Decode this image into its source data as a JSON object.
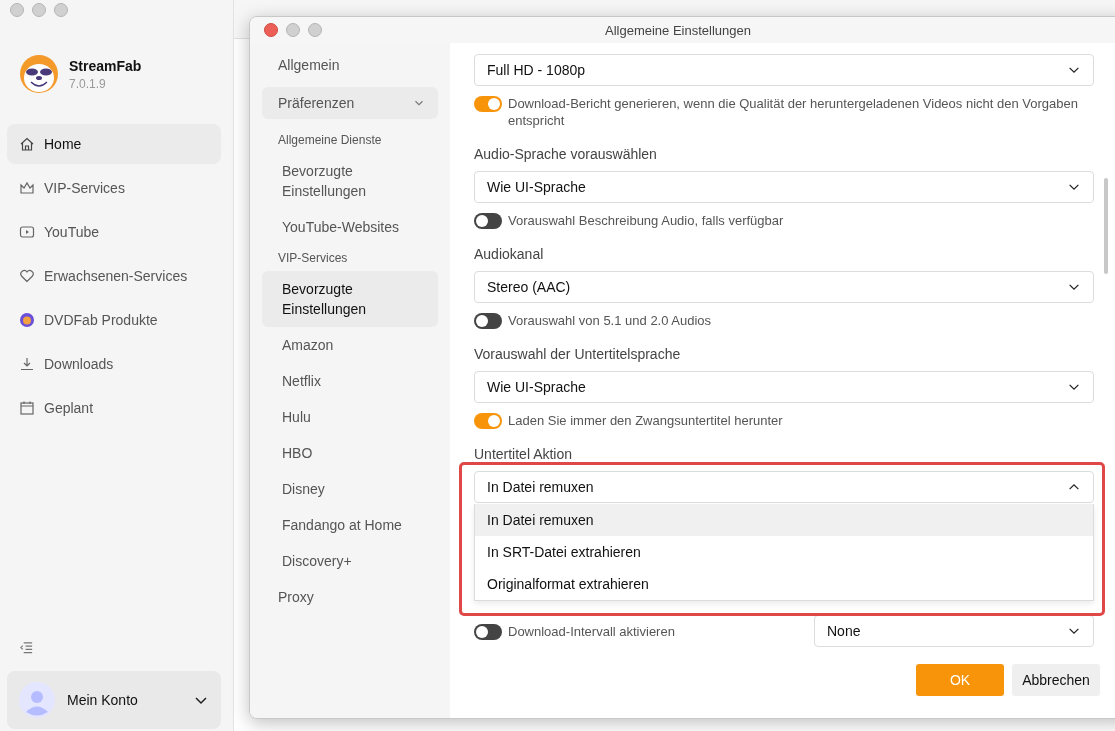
{
  "app": {
    "name": "StreamFab",
    "version": "7.0.1.9",
    "nav": [
      {
        "label": "Home",
        "selected": true
      },
      {
        "label": "VIP-Services",
        "selected": false
      },
      {
        "label": "YouTube",
        "selected": false
      },
      {
        "label": "Erwachsenen-Services",
        "selected": false
      },
      {
        "label": "DVDFab Produkte",
        "selected": false
      },
      {
        "label": "Downloads",
        "selected": false
      },
      {
        "label": "Geplant",
        "selected": false
      }
    ],
    "account": {
      "label": "Mein Konto"
    }
  },
  "dialog": {
    "title": "Allgemeine Einstellungen",
    "nav": [
      {
        "kind": "item",
        "label": "Allgemein",
        "selected": false
      },
      {
        "kind": "group",
        "label": "Präferenzen",
        "expanded": true
      },
      {
        "kind": "section",
        "label": "Allgemeine Dienste"
      },
      {
        "kind": "sub",
        "label": "Bevorzugte Einstellungen",
        "selected": false
      },
      {
        "kind": "sub",
        "label": "YouTube-Websites",
        "selected": false
      },
      {
        "kind": "section",
        "label": "VIP-Services"
      },
      {
        "kind": "sub",
        "label": "Bevorzugte Einstellungen",
        "selected": true
      },
      {
        "kind": "sub",
        "label": "Amazon",
        "selected": false
      },
      {
        "kind": "sub",
        "label": "Netflix",
        "selected": false
      },
      {
        "kind": "sub",
        "label": "Hulu",
        "selected": false
      },
      {
        "kind": "sub",
        "label": "HBO",
        "selected": false
      },
      {
        "kind": "sub",
        "label": "Disney",
        "selected": false
      },
      {
        "kind": "sub",
        "label": "Fandango at Home",
        "selected": false
      },
      {
        "kind": "sub",
        "label": "Discovery+",
        "selected": false
      },
      {
        "kind": "item",
        "label": "Proxy",
        "selected": false
      }
    ],
    "settings": [
      {
        "kind": "select",
        "value": "Full HD - 1080p",
        "expanded": false
      },
      {
        "kind": "toggle",
        "label": "Download-Bericht generieren, wenn die Qualität der heruntergeladenen Videos nicht den Vorgaben entspricht",
        "on": true
      },
      {
        "kind": "label",
        "label": "Audio-Sprache vorauswählen"
      },
      {
        "kind": "select",
        "value": "Wie UI-Sprache",
        "expanded": false
      },
      {
        "kind": "toggle",
        "label": "Vorauswahl Beschreibung Audio, falls verfügbar",
        "on": false
      },
      {
        "kind": "label",
        "label": "Audiokanal"
      },
      {
        "kind": "select",
        "value": "Stereo (AAC)",
        "expanded": false
      },
      {
        "kind": "toggle",
        "label": "Vorauswahl von 5.1 und 2.0 Audios",
        "on": false
      },
      {
        "kind": "label",
        "label": "Vorauswahl der Untertitelsprache"
      },
      {
        "kind": "select",
        "value": "Wie UI-Sprache",
        "expanded": false
      },
      {
        "kind": "toggle",
        "label": "Laden Sie immer den Zwangsuntertitel herunter",
        "on": true
      },
      {
        "kind": "label",
        "label": "Untertitel Aktion"
      },
      {
        "kind": "select",
        "value": "In Datei remuxen",
        "expanded": true,
        "highlighted": true,
        "options": [
          {
            "label": "In Datei remuxen",
            "selected": true
          },
          {
            "label": "In SRT-Datei extrahieren",
            "selected": false
          },
          {
            "label": "Originalformat extrahieren",
            "selected": false
          }
        ]
      },
      {
        "kind": "toggle-select",
        "label": "Download-Intervall aktivieren",
        "on": false,
        "value": "None"
      }
    ],
    "buttons": [
      {
        "label": "OK",
        "kind": "primary"
      },
      {
        "label": "Abbrechen",
        "kind": "secondary"
      }
    ]
  }
}
